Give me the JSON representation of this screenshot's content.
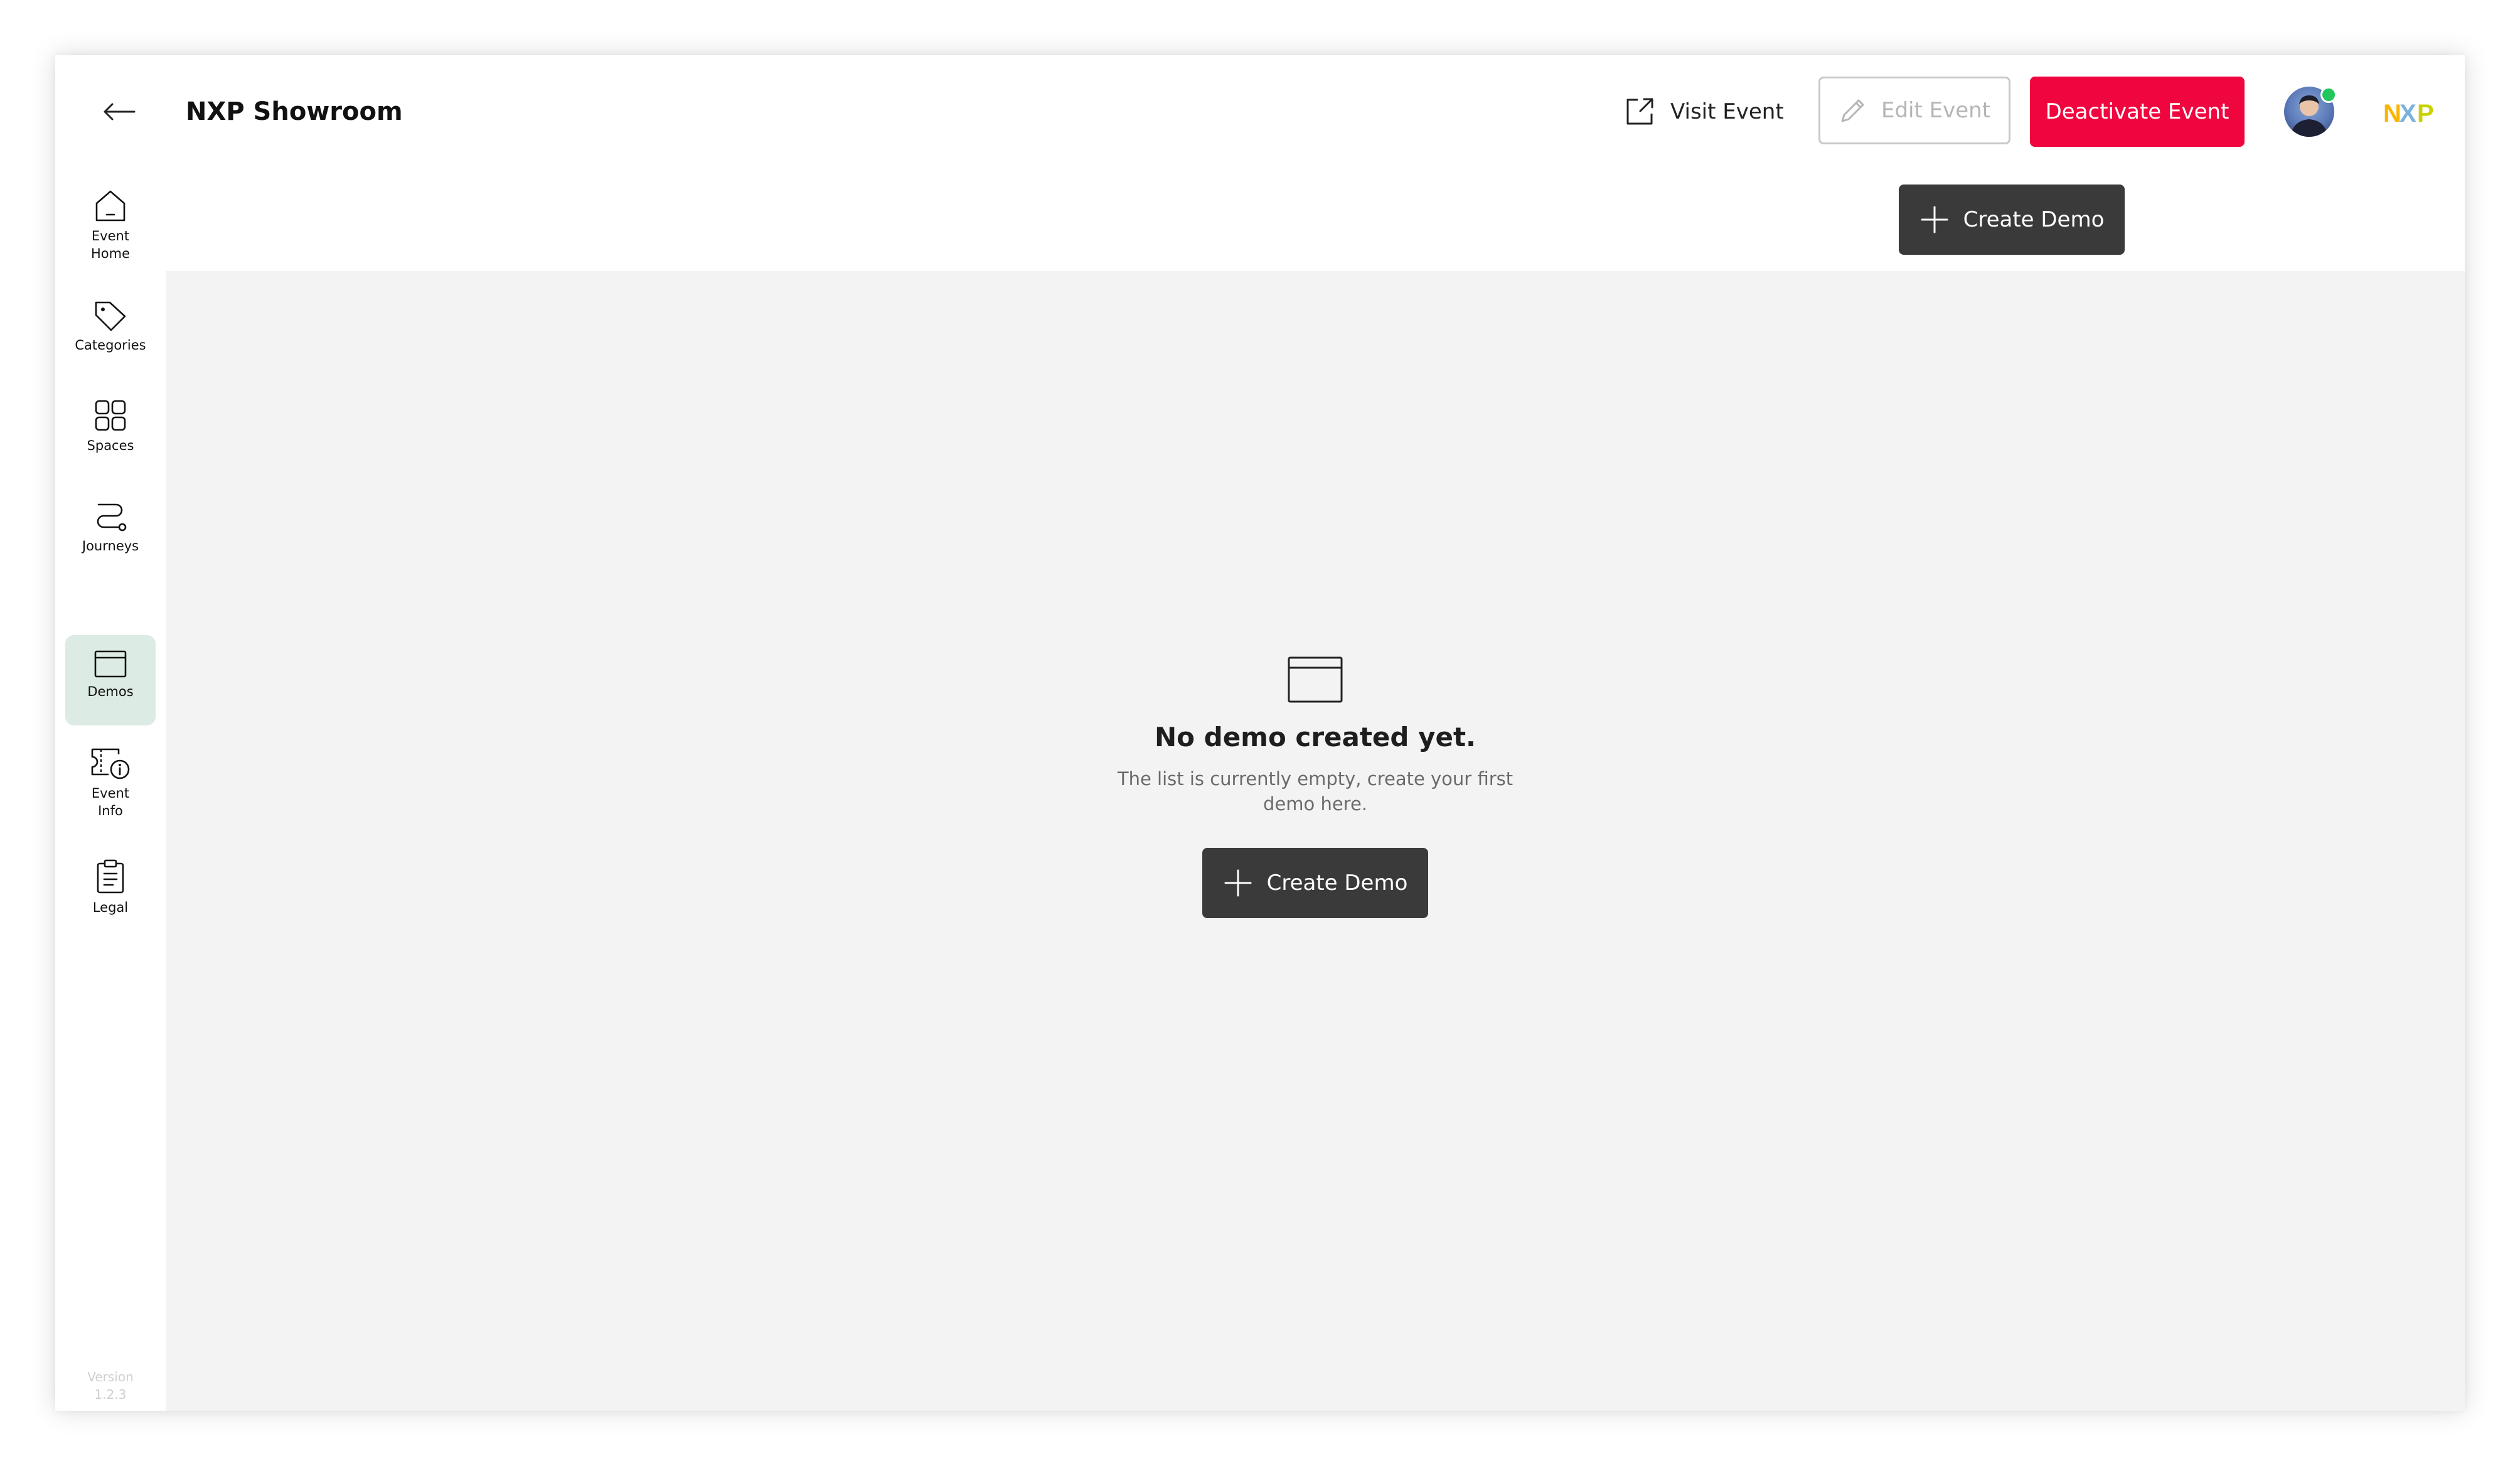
{
  "header": {
    "title": "NXP Showroom",
    "back_icon": "arrow-left-icon",
    "visit_event_label": "Visit Event",
    "edit_event_label": "Edit Event",
    "deactivate_label": "Deactivate Event",
    "logo_text": "NXP"
  },
  "sidebar": {
    "items": [
      {
        "label": "Event\nHome",
        "icon": "home-icon"
      },
      {
        "label": "Categories",
        "icon": "tag-icon"
      },
      {
        "label": "Spaces",
        "icon": "spaces-icon"
      },
      {
        "label": "Journeys",
        "icon": "route-icon"
      },
      {
        "label": "Demos",
        "icon": "browser-window-icon",
        "active": true
      },
      {
        "label": "Event\nInfo",
        "icon": "ticket-info-icon"
      },
      {
        "label": "Legal",
        "icon": "clipboard-icon"
      }
    ],
    "version_label": "Version",
    "version_number": "1.2.3"
  },
  "toolbar": {
    "create_label": "Create Demo"
  },
  "empty_state": {
    "icon": "browser-window-icon",
    "title": "No demo created yet.",
    "description": "The list is currently empty, create your first demo here.",
    "button_label": "Create Demo"
  },
  "colors": {
    "accent_red": "#f0063f",
    "dark_button": "#3a3a3a",
    "active_nav_bg": "#dcebe3",
    "content_bg": "#f3f3f3",
    "logo_yellow": "#f9b500",
    "logo_blue": "#7bb1db",
    "logo_green": "#c9d200",
    "status_green": "#22c55e"
  }
}
